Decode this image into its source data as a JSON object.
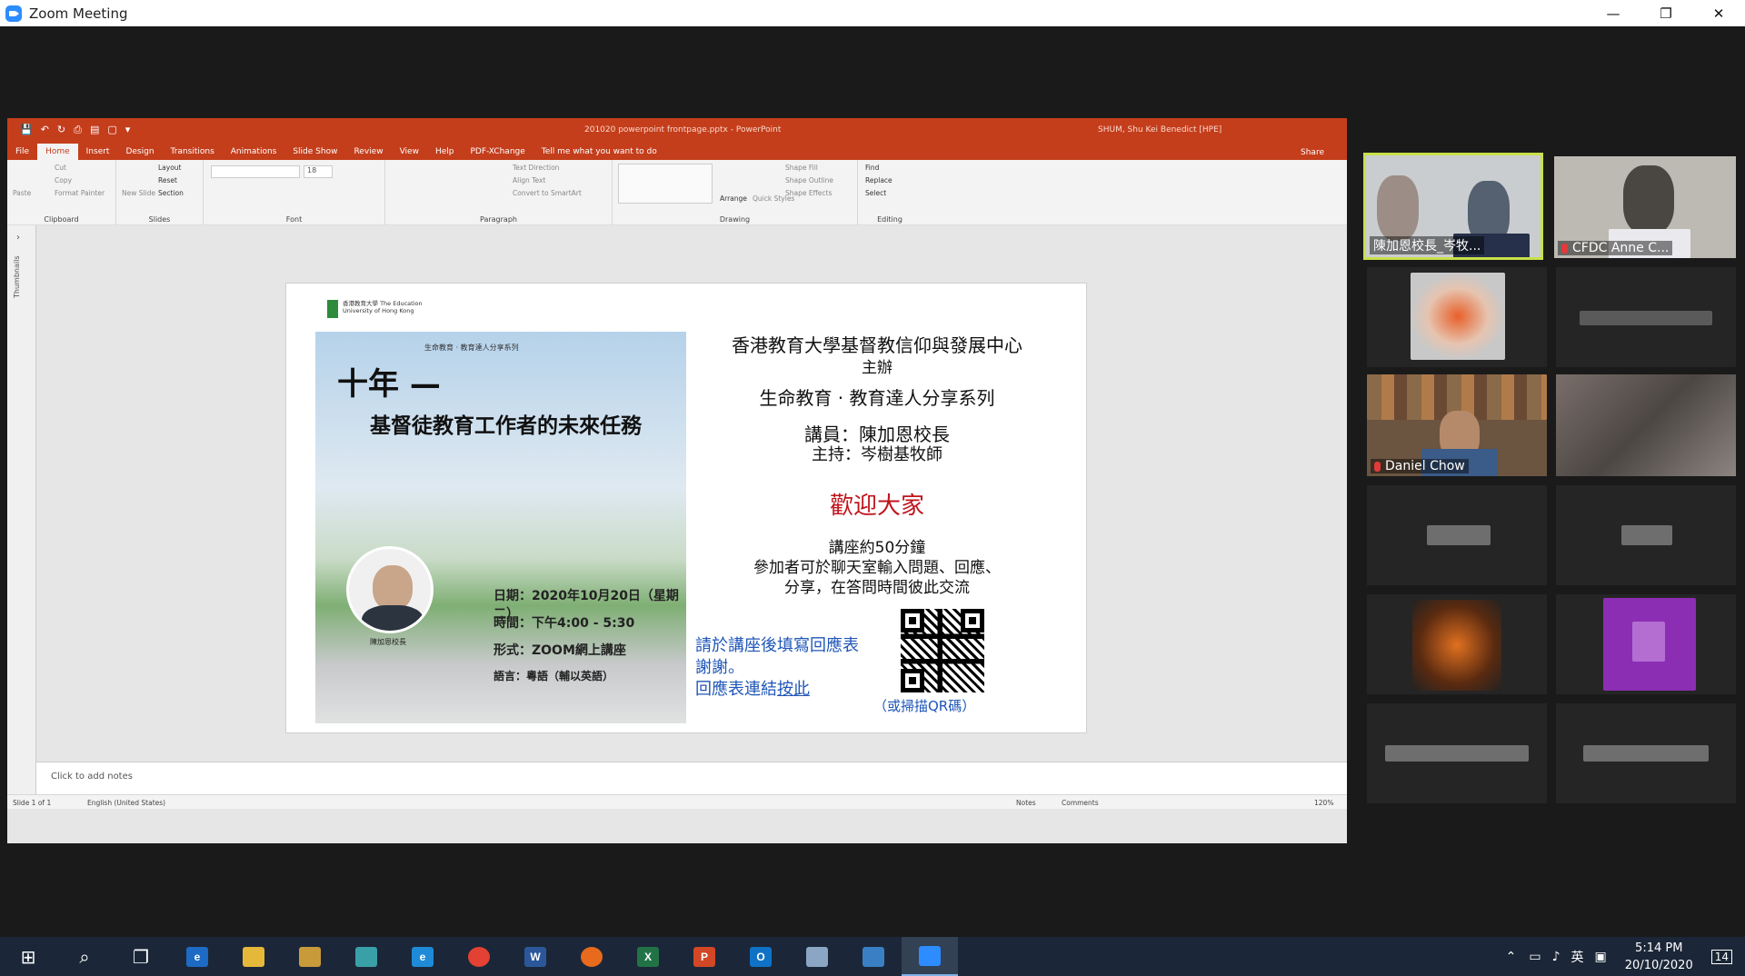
{
  "window": {
    "title": "Zoom Meeting",
    "controls": [
      "—",
      "❐",
      "✕"
    ]
  },
  "ppt": {
    "qat": [
      "💾",
      "↶",
      "↻",
      "⎙",
      "▤",
      "▢",
      "▾"
    ],
    "doc_title": "201020 powerpoint frontpage.pptx  -  PowerPoint",
    "user": "SHUM, Shu Kei Benedict [HPE]",
    "tabs": [
      "File",
      "Home",
      "Insert",
      "Design",
      "Transitions",
      "Animations",
      "Slide Show",
      "Review",
      "View",
      "Help",
      "PDF-XChange",
      "Tell me what you want to do"
    ],
    "share": "Share",
    "groups": {
      "clipboard": "Clipboard",
      "slides": "Slides",
      "font": "Font",
      "paragraph": "Paragraph",
      "drawing": "Drawing",
      "editing": "Editing"
    },
    "clipboard": {
      "paste": "Paste",
      "cut": "Cut",
      "copy": "Copy",
      "format_painter": "Format Painter"
    },
    "slides": {
      "new_slide": "New Slide",
      "layout": "Layout",
      "reset": "Reset",
      "section": "Section"
    },
    "font_size": "18",
    "paragraph": {
      "text_direction": "Text Direction",
      "align_text": "Align Text",
      "convert": "Convert to SmartArt"
    },
    "drawing": {
      "arrange": "Arrange",
      "quick_styles": "Quick Styles",
      "shape_fill": "Shape Fill",
      "shape_outline": "Shape Outline",
      "shape_effects": "Shape Effects"
    },
    "editing": {
      "find": "Find",
      "replace": "Replace",
      "select": "Select"
    },
    "thumbnails": "Thumbnails",
    "notes_placeholder": "Click to add notes",
    "status": {
      "slide": "Slide 1 of 1",
      "lang": "English (United States)",
      "notes": "Notes",
      "comments": "Comments",
      "zoom": "120%"
    }
  },
  "slide": {
    "logo_text": "香港教育大學 The Education University of Hong Kong",
    "poster_series": "生命教育 · 教育達人分享系列",
    "poster_title1": "十年 —",
    "poster_title2": "基督徒教育工作者的未來任務",
    "poster_date": "日期：2020年10月20日（星期二）",
    "poster_time": "時間：下午4:00 - 5:30",
    "poster_format": "形式：ZOOM網上講座",
    "poster_lang": "語言：粵語（輔以英語）",
    "speaker_label": "陳加恩校長",
    "line1": "香港教育大學基督教信仰與發展中心",
    "line2": "主辦",
    "line3": "生命教育 · 教育達人分享系列",
    "line4": "講員：陳加恩校長",
    "line5": "主持：岑樹基牧師",
    "welcome": "歡迎大家",
    "dur": "講座約50分鐘",
    "chat1": "參加者可於聊天室輸入問題、回應、",
    "chat2": "分享，在答問時間彼此交流",
    "fb1": "請於講座後填寫回應表",
    "fb2": "謝謝。",
    "fb3": "回應表連結",
    "fb_link": "按此",
    "qr_caption": "（或掃描QR碼）"
  },
  "participants": [
    {
      "name": "陳加恩校長_岑牧...",
      "muted": false
    },
    {
      "name": "CFDC Anne C...",
      "muted": true
    },
    {
      "name": "Daniel Chow",
      "muted": true
    }
  ],
  "taskbar": {
    "ime": "英",
    "time": "5:14 PM",
    "date": "20/10/2020",
    "notif": "14"
  },
  "colors": {
    "ppt_red": "#c43e1c",
    "welcome_red": "#c0141c",
    "link_blue": "#1f56b8",
    "active_speaker": "#c8e04a"
  }
}
